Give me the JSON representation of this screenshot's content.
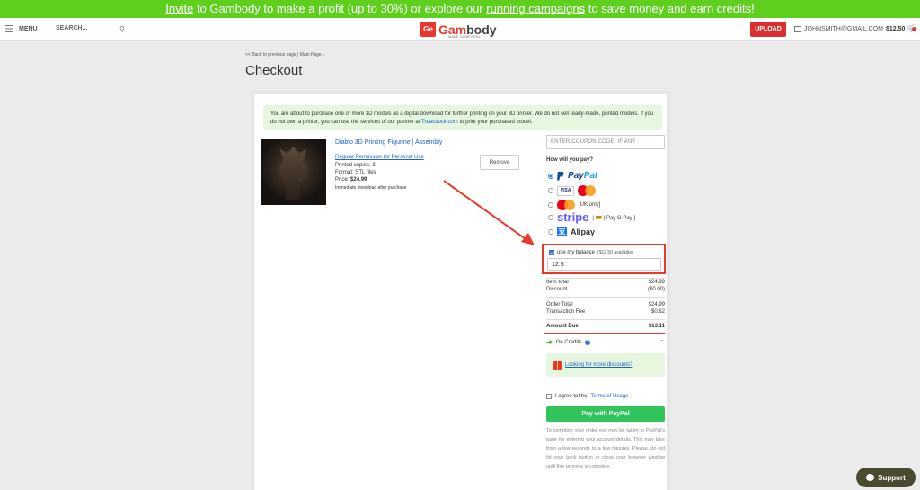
{
  "promo": {
    "invite_link": "Invite",
    "text_1": " to Gambody to make a profit (up to 30%) or explore our ",
    "campaigns_link": "running campaigns",
    "text_2": " to save money and earn credits!"
  },
  "header": {
    "menu_label": "MENU",
    "search_placeholder": "SEARCH...",
    "logo_badge": "Ge",
    "logo_part1": "Gam",
    "logo_part2": "body",
    "logo_tagline": "MAKE GAME REAL",
    "upload_label": "UPLOAD",
    "account_email": "JOHNSMITH@GMAIL.COM",
    "account_balance": "$12.50"
  },
  "breadcrumb": {
    "back": "<< Back to previous page",
    "sep1": " | ",
    "main": "Main Page",
    "sep2": " \\"
  },
  "page_title": "Checkout",
  "notice": {
    "text_1": "You are about to purchase one or more 3D models as a digital download for further printing on your 3D printer. We do not sell ready-made, printed models. If you do not own a printer, you can use the services of our partner at ",
    "partner_link": "Treatstock.com",
    "text_2": " to print your purchased model."
  },
  "product": {
    "title": "Diablo 3D Printing Figurine | Assembly",
    "permission": "Regular Permission for Personal Use",
    "copies": "Printed copies: 3",
    "format": "Format: STL files",
    "price_label": "Price: ",
    "price_value": "$24.99",
    "delivery": "Immediate download after purchase",
    "remove_label": "Remove"
  },
  "payment": {
    "coupon_placeholder": "ENTER COUPON CODE, IF ANY",
    "how_label": "How will you pay?",
    "paypal_p1": "Pay",
    "paypal_p2": "Pal",
    "visa_label": "VISA",
    "uk_only": "[UK only]",
    "stripe_label": "stripe",
    "stripe_extras": "| 💳 | Pay G Pay ]",
    "alipay_label": "Alipay",
    "alipay_mark": "支"
  },
  "balance": {
    "label": "use my balance",
    "available": "($12.50 available)",
    "value": "12.5"
  },
  "summary": {
    "item_total_label": "Item total",
    "item_total_value": "$24.99",
    "discount_label": "Discount",
    "discount_value": "($0.00)",
    "order_total_label": "Order Total",
    "order_total_value": "$24.99",
    "fee_label": "Transaction Fee",
    "fee_value": "$0.62",
    "due_label": "Amount Due",
    "due_value": "$13.11"
  },
  "credits": {
    "label": "Ge Credits",
    "value": "-"
  },
  "discounts_link": "Looking for more discounts?",
  "agree": {
    "text": "I agree to the ",
    "terms_link": "Terms of Usage"
  },
  "pay_button": "Pay with PayPal",
  "pay_note": "To complete your order you may be taken to PayPal's page for entering your account details. This may take from a few seconds to a few minutes. Please, do not hit your back button or close your browser window until this process is complete.",
  "support_label": "Support",
  "colors": {
    "promo_green": "#5fcf1e",
    "brand_red": "#e8382b",
    "pay_green": "#30c45b",
    "link_blue": "#1a66c9"
  }
}
